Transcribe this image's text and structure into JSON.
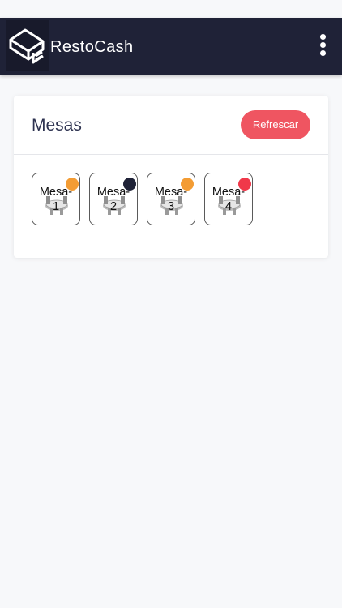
{
  "app": {
    "brand": "RestoCash",
    "logo_icon": "restocash-logo-icon",
    "menu_icon": "more-vert-icon",
    "colors": {
      "appbar": "#1f2237",
      "background": "#f7f8fa",
      "accent": "#ef5561"
    }
  },
  "panel": {
    "title": "Mesas",
    "refresh_label": "Refrescar"
  },
  "tables": [
    {
      "label": "Mesa-1",
      "status_color": "#f39c34"
    },
    {
      "label": "Mesa-2",
      "status_color": "#1f2237"
    },
    {
      "label": "Mesa-3",
      "status_color": "#f39c34"
    },
    {
      "label": "Mesa-4",
      "status_color": "#f0384a"
    }
  ]
}
